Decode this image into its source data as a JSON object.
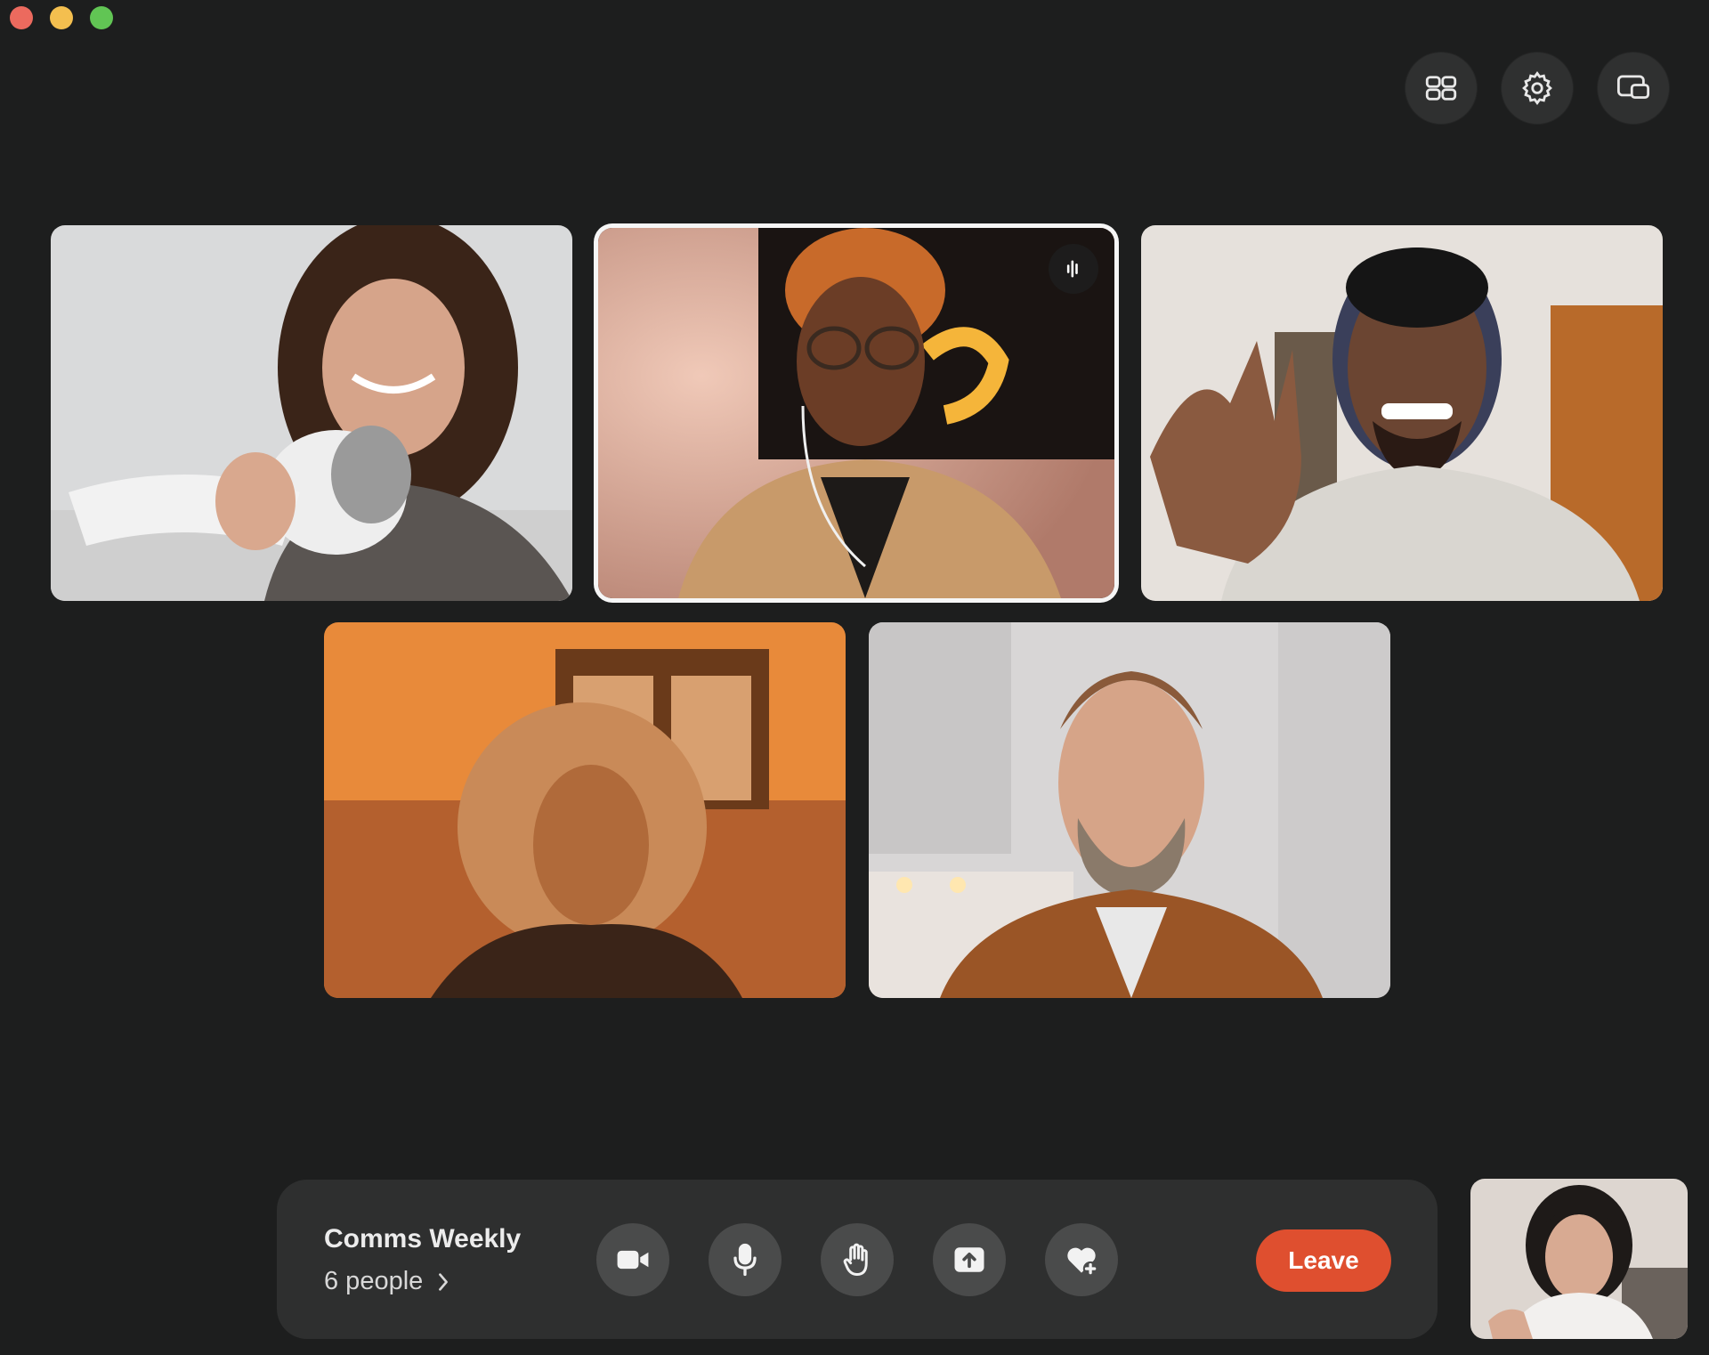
{
  "window": {
    "controls": [
      "close",
      "minimize",
      "zoom"
    ]
  },
  "toolbar": {
    "buttons": [
      {
        "icon": "grid-layout-icon"
      },
      {
        "icon": "gear-icon"
      },
      {
        "icon": "picture-in-picture-icon"
      }
    ]
  },
  "participants": [
    {
      "tile": "participant-1",
      "scene": "woman with curly hair holding a cat",
      "speaking": false
    },
    {
      "tile": "participant-2",
      "scene": "woman with glasses and earphones",
      "speaking": true
    },
    {
      "tile": "participant-3",
      "scene": "man with headphones waving",
      "speaking": false
    },
    {
      "tile": "participant-4",
      "scene": "woman with windblown hair, orange tone",
      "speaking": false
    },
    {
      "tile": "participant-5",
      "scene": "bearded man in brown shirt",
      "speaking": false
    }
  ],
  "meeting": {
    "title": "Comms Weekly",
    "people_count": "6 people"
  },
  "controls": {
    "buttons": [
      {
        "icon": "video-camera-icon"
      },
      {
        "icon": "microphone-icon"
      },
      {
        "icon": "raise-hand-icon"
      },
      {
        "icon": "share-screen-icon"
      },
      {
        "icon": "add-reaction-icon"
      }
    ],
    "leave_label": "Leave"
  },
  "colors": {
    "background": "#1d1e1e",
    "control_bar": "#2e2f2f",
    "control_button": "#4a4b4b",
    "leave": "#df4f2f"
  }
}
